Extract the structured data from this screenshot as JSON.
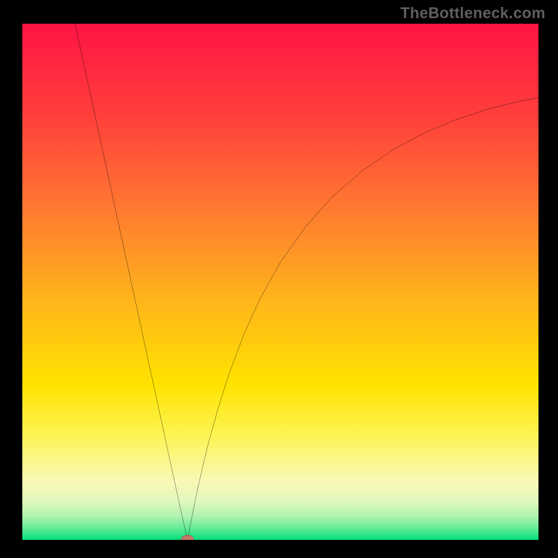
{
  "watermark": "TheBottleneck.com",
  "chart_data": {
    "type": "line",
    "title": "",
    "xlabel": "",
    "ylabel": "",
    "xlim": [
      0,
      100
    ],
    "ylim": [
      0,
      100
    ],
    "curve_left": {
      "x": [
        10,
        12,
        14,
        16,
        18,
        20,
        22,
        24,
        26,
        27,
        28,
        29,
        30,
        31,
        32
      ],
      "y": [
        101,
        91.8,
        82.6,
        73.4,
        64.2,
        55.0,
        45.8,
        36.6,
        27.4,
        22.8,
        18.2,
        13.6,
        9.0,
        4.4,
        0.0
      ]
    },
    "curve_right": {
      "x": [
        32,
        33,
        34,
        35,
        36,
        38,
        40,
        43,
        46,
        50,
        55,
        60,
        66,
        72,
        78,
        84,
        90,
        96,
        100
      ],
      "y": [
        0.0,
        5.2,
        10.0,
        14.4,
        18.5,
        25.7,
        32.0,
        40.0,
        46.6,
        53.8,
        60.8,
        66.4,
        71.6,
        75.7,
        78.9,
        81.4,
        83.4,
        84.9,
        85.7
      ]
    },
    "marker": {
      "x": 32,
      "y": 0
    },
    "gradient_stops": [
      {
        "offset": 0.0,
        "color": "#ff1444"
      },
      {
        "offset": 0.18,
        "color": "#ff3f3b"
      },
      {
        "offset": 0.36,
        "color": "#ff7a30"
      },
      {
        "offset": 0.54,
        "color": "#ffb61a"
      },
      {
        "offset": 0.7,
        "color": "#ffe300"
      },
      {
        "offset": 0.8,
        "color": "#fdf456"
      },
      {
        "offset": 0.885,
        "color": "#faf9b5"
      },
      {
        "offset": 0.925,
        "color": "#e1f8bc"
      },
      {
        "offset": 0.955,
        "color": "#aef3af"
      },
      {
        "offset": 0.978,
        "color": "#60eb96"
      },
      {
        "offset": 1.0,
        "color": "#01de7a"
      }
    ]
  }
}
